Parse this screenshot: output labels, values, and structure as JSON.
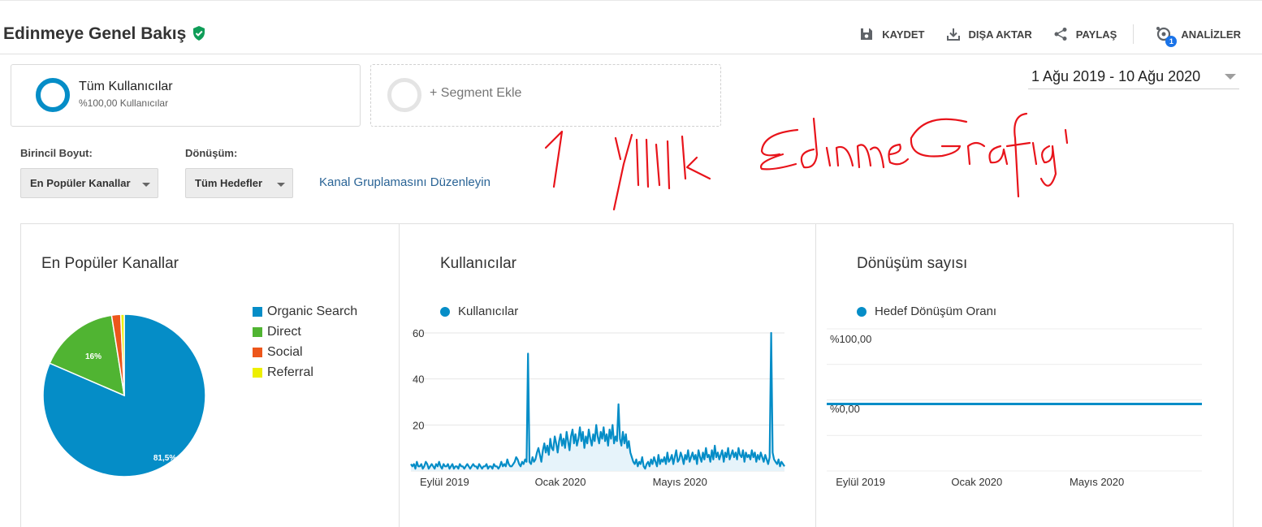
{
  "header": {
    "title": "Edinmeye Genel Bakış",
    "actions": {
      "save": "KAYDET",
      "export": "DIŞA AKTAR",
      "share": "PAYLAŞ",
      "insights": "ANALİZLER",
      "insights_badge": "1"
    }
  },
  "segments": {
    "active_title": "Tüm Kullanıcılar",
    "active_sub": "%100,00 Kullanıcılar",
    "add_label": "+ Segment Ekle"
  },
  "date_range": "1 Ağu 2019 - 10 Ağu 2020",
  "annotation": "1 Yıllık Edinme Grafiği",
  "controls": {
    "primary_dim_label": "Birincil Boyut:",
    "primary_dim_value": "En Popüler Kanallar",
    "conversion_label": "Dönüşüm:",
    "conversion_value": "Tüm Hedefler",
    "edit_link": "Kanal Gruplamasını Düzenleyin"
  },
  "colors": {
    "organic": "#058dc7",
    "direct": "#50b432",
    "social": "#ed561b",
    "referral": "#edef00",
    "verified": "#0f9d58",
    "link": "#2a6496"
  },
  "panels": {
    "channels_title": "En Popüler Kanallar",
    "users_title": "Kullanıcılar",
    "conversions_title": "Dönüşüm sayısı"
  },
  "chart_data": [
    {
      "type": "pie",
      "title": "En Popüler Kanallar",
      "slices": [
        {
          "name": "Organic Search",
          "value": 81.5,
          "label": "81,5%"
        },
        {
          "name": "Direct",
          "value": 16,
          "label": "16%"
        },
        {
          "name": "Social",
          "value": 1.8,
          "label": ""
        },
        {
          "name": "Referral",
          "value": 0.7,
          "label": ""
        }
      ],
      "legend_position": "right"
    },
    {
      "type": "area",
      "title": "Kullanıcılar",
      "series_name": "Kullanıcılar",
      "ylim": [
        0,
        60
      ],
      "yticks": [
        "60",
        "40",
        "20"
      ],
      "ytick_values": [
        60,
        40,
        20
      ],
      "xticks": [
        "Eylül 2019",
        "Ocak 2020",
        "Mayıs 2020"
      ],
      "xtick_positions": [
        0.09,
        0.4,
        0.72
      ],
      "grid": true,
      "values": [
        3,
        2,
        3,
        1,
        4,
        2,
        2,
        3,
        1,
        2,
        4,
        3,
        1,
        2,
        3,
        2,
        1,
        3,
        2,
        4,
        2,
        1,
        3,
        2,
        2,
        3,
        1,
        2,
        3,
        1,
        2,
        2,
        1,
        3,
        2,
        2,
        1,
        2,
        3,
        2,
        1,
        2,
        3,
        2,
        2,
        1,
        3,
        2,
        1,
        2,
        2,
        3,
        1,
        2,
        2,
        1,
        3,
        2,
        2,
        1,
        2,
        4,
        2,
        3,
        2,
        5,
        3,
        2,
        2,
        3,
        4,
        6,
        5,
        3,
        2,
        4,
        3,
        5,
        4,
        51,
        4,
        3,
        6,
        4,
        5,
        8,
        10,
        7,
        4,
        9,
        12,
        8,
        11,
        7,
        14,
        10,
        9,
        15,
        12,
        8,
        13,
        16,
        11,
        14,
        10,
        17,
        13,
        9,
        15,
        18,
        12,
        16,
        11,
        14,
        19,
        13,
        17,
        10,
        15,
        12,
        18,
        14,
        11,
        16,
        13,
        20,
        15,
        12,
        17,
        14,
        19,
        13,
        16,
        11,
        18,
        14,
        20,
        12,
        15,
        13,
        29,
        14,
        11,
        17,
        12,
        16,
        10,
        13,
        8,
        6,
        4,
        3,
        5,
        2,
        4,
        3,
        6,
        2,
        1,
        3,
        4,
        2,
        5,
        3,
        6,
        4,
        2,
        7,
        3,
        5,
        4,
        6,
        3,
        8,
        4,
        5,
        7,
        3,
        6,
        9,
        4,
        5,
        8,
        6,
        3,
        7,
        5,
        9,
        4,
        6,
        8,
        5,
        7,
        3,
        9,
        6,
        4,
        8,
        5,
        10,
        6,
        7,
        4,
        9,
        5,
        11,
        6,
        8,
        5,
        7,
        9,
        4,
        8,
        6,
        10,
        5,
        7,
        9,
        6,
        8,
        5,
        10,
        7,
        6,
        9,
        4,
        8,
        6,
        7,
        5,
        9,
        6,
        8,
        4,
        7,
        5,
        8,
        6,
        4,
        7,
        5,
        3,
        6,
        60,
        8,
        5,
        4,
        3,
        5,
        2,
        4,
        3,
        2
      ]
    },
    {
      "type": "line",
      "title": "Dönüşüm sayısı",
      "series_name": "Hedef Dönüşüm Oranı",
      "ylim": [
        0,
        100
      ],
      "yticks": [
        "%100,00",
        "%0,00"
      ],
      "ytick_values": [
        100,
        0
      ],
      "xticks": [
        "Eylül 2019",
        "Ocak 2020",
        "Mayıs 2020"
      ],
      "xtick_positions": [
        0.09,
        0.4,
        0.72
      ],
      "grid": true,
      "values": [
        0,
        0,
        0,
        0,
        0,
        0,
        0,
        0,
        0,
        0,
        0,
        0
      ]
    }
  ]
}
